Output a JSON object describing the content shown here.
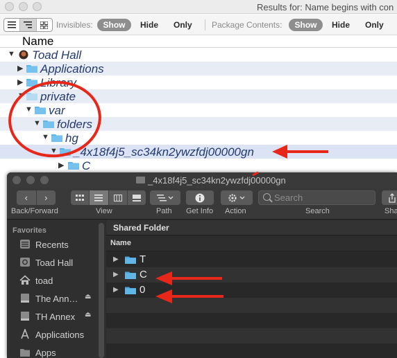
{
  "results_window": {
    "title": "Results for: Name begins with con",
    "toolbar": {
      "view_modes": [
        "list-view-icon",
        "outline-view-icon",
        "icon-view-icon"
      ],
      "invisibles_label": "Invisibles:",
      "invisibles_show": "Show",
      "invisibles_hide": "Hide",
      "invisibles_only": "Only",
      "package_label": "Package Contents:",
      "package_show": "Show",
      "package_hide": "Hide",
      "package_only": "Only"
    },
    "column_header": "Name",
    "rows": [
      {
        "name": "Toad Hall",
        "icon": "disk-icon",
        "expanded": true
      },
      {
        "name": "Applications",
        "icon": "folder-icon",
        "expanded": false
      },
      {
        "name": "Library",
        "icon": "folder-icon",
        "expanded": false
      },
      {
        "name": "private",
        "icon": "folder-icon",
        "expanded": true
      },
      {
        "name": "var",
        "icon": "folder-icon",
        "expanded": true
      },
      {
        "name": "folders",
        "icon": "folder-icon",
        "expanded": true
      },
      {
        "name": "hg",
        "icon": "folder-icon",
        "expanded": true
      },
      {
        "name": "_4x18f4j5_sc34kn2ywzfdj00000gn",
        "icon": "folder-icon",
        "expanded": true
      },
      {
        "name": "C",
        "icon": "folder-icon",
        "expanded": false
      }
    ]
  },
  "finder_window": {
    "title": "_4x18f4j5_sc34kn2ywzfdj00000gn",
    "toolbar": {
      "back_forward": "Back/Forward",
      "view": "View",
      "path": "Path",
      "get_info": "Get Info",
      "action": "Action",
      "search_label": "Search",
      "search_placeholder": "Search",
      "share": "Sha"
    },
    "sidebar": {
      "heading": "Favorites",
      "items": [
        {
          "label": "Recents",
          "icon": "recents-icon",
          "eject": false
        },
        {
          "label": "Toad Hall",
          "icon": "disk-icon",
          "eject": false
        },
        {
          "label": "toad",
          "icon": "home-icon",
          "eject": false
        },
        {
          "label": "The Ann…",
          "icon": "drive-icon",
          "eject": true
        },
        {
          "label": "TH Annex",
          "icon": "drive-icon",
          "eject": true
        },
        {
          "label": "Applications",
          "icon": "applications-icon",
          "eject": false
        },
        {
          "label": "Apps",
          "icon": "folder-icon",
          "eject": false
        }
      ]
    },
    "path_bar": "Shared Folder",
    "column_header": "Name",
    "items": [
      {
        "name": "T"
      },
      {
        "name": "C"
      },
      {
        "name": "0"
      }
    ]
  },
  "colors": {
    "folder_blue": "#5fb4e6",
    "annotation_red": "#e8271b",
    "tree_text": "#243a6f",
    "row_stripe": "#e8ecf5"
  }
}
